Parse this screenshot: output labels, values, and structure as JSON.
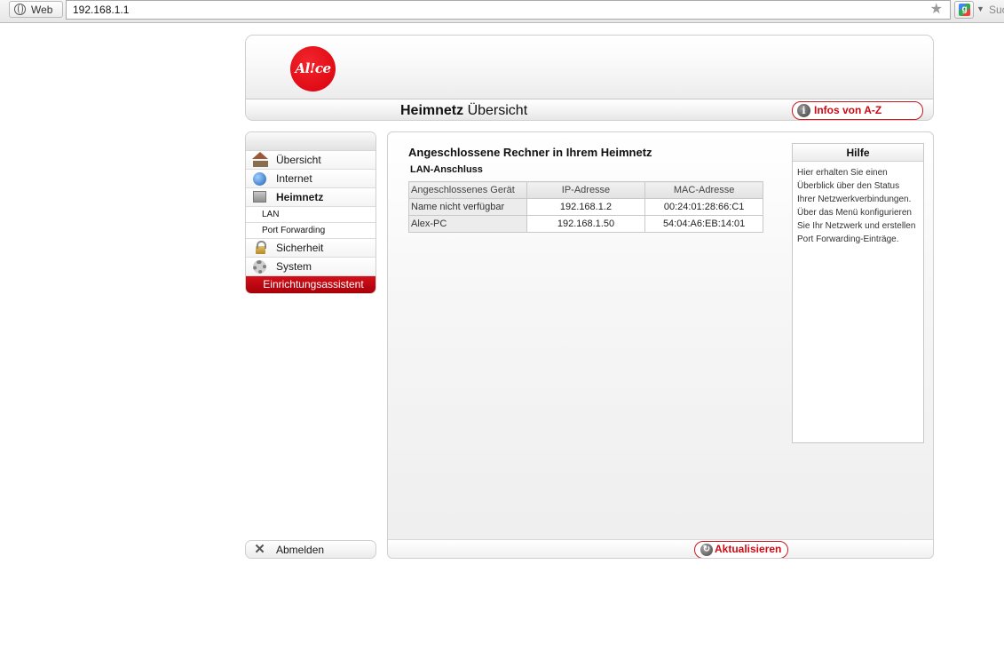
{
  "browser": {
    "tab_chip": "Web",
    "url": "192.168.1.1",
    "search_placeholder": "Suc"
  },
  "header": {
    "logo_text": "Alice",
    "title_bold": "Heimnetz",
    "title_rest": " Übersicht",
    "infos_button": "Infos von A-Z"
  },
  "sidebar": {
    "items": [
      {
        "label": "Übersicht",
        "icon": "home-icon"
      },
      {
        "label": "Internet",
        "icon": "globe-icon"
      },
      {
        "label": "Heimnetz",
        "icon": "network-icon",
        "active": true
      },
      {
        "label": "Sicherheit",
        "icon": "lock-icon"
      },
      {
        "label": "System",
        "icon": "gear-icon"
      }
    ],
    "sub_items": [
      "LAN",
      "Port Forwarding"
    ],
    "wizard_button": "Einrichtungsassistent",
    "logout_label": "Abmelden"
  },
  "main": {
    "section_title": "Angeschlossene Rechner in Ihrem Heimnetz",
    "sub_title": "LAN-Anschluss",
    "table": {
      "headers": [
        "Angeschlossenes Gerät",
        "IP-Adresse",
        "MAC-Adresse"
      ],
      "rows": [
        [
          "Name nicht verfügbar",
          "192.168.1.2",
          "00:24:01:28:66:C1"
        ],
        [
          "Alex-PC",
          "192.168.1.50",
          "54:04:A6:EB:14:01"
        ]
      ]
    },
    "refresh_button": "Aktualisieren"
  },
  "help": {
    "title": "Hilfe",
    "text": "Hier erhalten Sie einen Überblick über den Status Ihrer Netzwerkverbindungen. Über das Menü konfigurieren Sie Ihr Netzwerk und erstellen Port Forwarding-Einträge."
  },
  "colors": {
    "brand_red": "#cc0a14",
    "wizard_red": "#c00010"
  }
}
